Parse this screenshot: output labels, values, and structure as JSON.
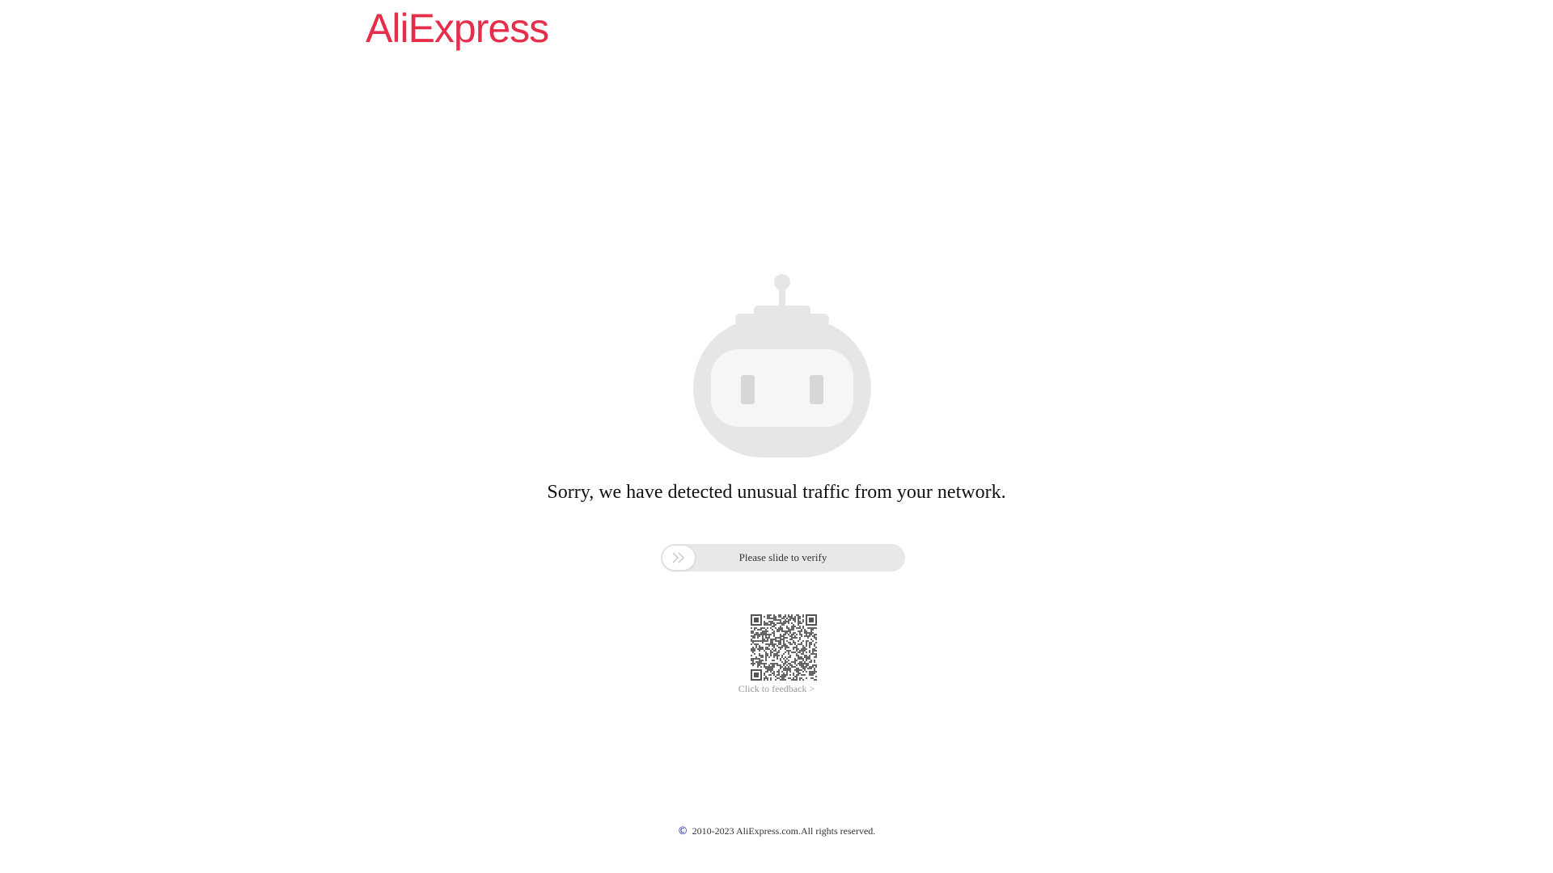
{
  "brand": {
    "logo_text": "AliExpress",
    "color": "#e62e4b"
  },
  "main": {
    "message": "Sorry, we have detected unusual traffic from your network.",
    "slider": {
      "label": "Please slide to verify",
      "handle_icon": "double-chevron-right-icon"
    },
    "qr_icon": "qr-code-icon",
    "feedback_link": "Click to feedback >"
  },
  "footer": {
    "copyright_icon": "copyright-icon",
    "copyright_symbol": "©",
    "text": "2010-2023 AliExpress.com.All rights reserved."
  },
  "colors": {
    "robot_gray": "#e6e6e6",
    "robot_eye": "#d7d7d7",
    "slider_track": "#e8e8e8",
    "copyright_icon": "#1b2b9e"
  }
}
